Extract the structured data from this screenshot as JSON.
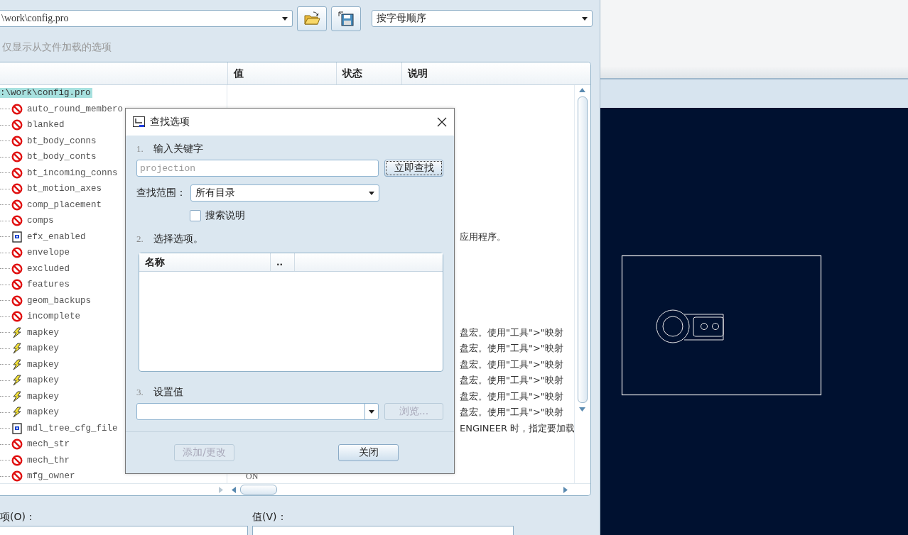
{
  "config_file": {
    "value": "\\work\\config.pro"
  },
  "sort": {
    "value": "按字母顺序"
  },
  "filter_option": {
    "label": "仅显示从文件加载的选项",
    "disabled": true
  },
  "table": {
    "columns": [
      "值",
      "状态",
      "说明"
    ],
    "root": {
      "name": ":\\work\\config.pro",
      "selected": true,
      "children": [
        {
          "name": "auto_round_membero",
          "kind": "prohibited",
          "selected": false
        },
        {
          "name": "blanked",
          "kind": "prohibited",
          "selected": false
        },
        {
          "name": "bt_body_conns",
          "kind": "prohibited",
          "selected": false
        },
        {
          "name": "bt_body_conts",
          "kind": "prohibited",
          "selected": false
        },
        {
          "name": "bt_incoming_conns",
          "kind": "prohibited",
          "selected": false
        },
        {
          "name": "bt_motion_axes",
          "kind": "prohibited",
          "selected": false
        },
        {
          "name": "comp_placement",
          "kind": "prohibited",
          "selected": false
        },
        {
          "name": "comps",
          "kind": "prohibited",
          "selected": false
        },
        {
          "name": "efx_enabled",
          "kind": "file",
          "selected": false,
          "description": "应用程序。"
        },
        {
          "name": "envelope",
          "kind": "prohibited",
          "selected": false
        },
        {
          "name": "excluded",
          "kind": "prohibited",
          "selected": false
        },
        {
          "name": "features",
          "kind": "prohibited",
          "selected": false
        },
        {
          "name": "geom_backups",
          "kind": "prohibited",
          "selected": false
        },
        {
          "name": "incomplete",
          "kind": "prohibited",
          "selected": false
        },
        {
          "name": "mapkey",
          "kind": "mapkey",
          "selected": false,
          "description": "盘宏。使用\"工具\">\"映射"
        },
        {
          "name": "mapkey",
          "kind": "mapkey",
          "selected": false,
          "description": "盘宏。使用\"工具\">\"映射"
        },
        {
          "name": "mapkey",
          "kind": "mapkey",
          "selected": false,
          "description": "盘宏。使用\"工具\">\"映射"
        },
        {
          "name": "mapkey",
          "kind": "mapkey",
          "selected": false,
          "description": "盘宏。使用\"工具\">\"映射"
        },
        {
          "name": "mapkey",
          "kind": "mapkey",
          "selected": false,
          "description": "盘宏。使用\"工具\">\"映射"
        },
        {
          "name": "mapkey",
          "kind": "mapkey",
          "selected": false,
          "description": "盘宏。使用\"工具\">\"映射"
        },
        {
          "name": "mdl_tree_cfg_file",
          "kind": "file",
          "selected": false,
          "description": "ENGINEER 时，指定要加载"
        },
        {
          "name": "mech_str",
          "kind": "prohibited",
          "selected": false
        },
        {
          "name": "mech_thr",
          "kind": "prohibited",
          "selected": false
        },
        {
          "name": "mfg_owner",
          "kind": "prohibited",
          "selected": false,
          "value": "ON"
        }
      ]
    }
  },
  "bottom": {
    "option_label": "项(O)：",
    "value_label": "值(V)："
  },
  "dialog": {
    "title": "查找选项",
    "step1": {
      "number": "1.",
      "label": "输入关键字"
    },
    "keyword": {
      "placeholder": "projection"
    },
    "search_button": {
      "label": "立即查找",
      "disabled": false
    },
    "scope": {
      "label": "查找范围：",
      "value": "所有目录"
    },
    "search_desc": {
      "label": "搜索说明",
      "checked": false
    },
    "step2": {
      "number": "2.",
      "label": "选择选项。"
    },
    "results": {
      "columns": [
        "名称",
        ".."
      ]
    },
    "step3": {
      "number": "3.",
      "label": "设置值"
    },
    "browse_button": {
      "label": "浏览...",
      "disabled": true
    },
    "add_button": {
      "label": "添加/更改",
      "disabled": true
    },
    "close_button": {
      "label": "关闭",
      "disabled": false
    }
  }
}
